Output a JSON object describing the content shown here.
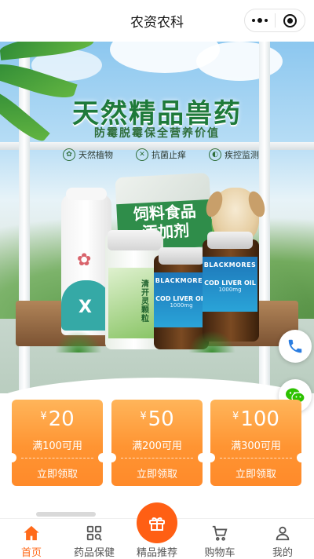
{
  "header": {
    "title": "农资农科",
    "menu_icon": "more-dots-icon",
    "close_icon": "target-close-icon"
  },
  "banner": {
    "headline": "天然精品兽药",
    "subline": "防霉脱霉保全营养价值",
    "features": [
      {
        "icon": "leaf-icon",
        "label": "天然植物"
      },
      {
        "icon": "shield-icon",
        "label": "抗菌止痒"
      },
      {
        "icon": "monitor-icon",
        "label": "疾控监测"
      }
    ],
    "bag_text_1": "饲料食品",
    "bag_text_2": "添加剂",
    "green_bottle_text": "清开灵颗粒",
    "brand": "BLACKMORES",
    "product": "COD LIVER OIL",
    "dose": "1000mg"
  },
  "floats": {
    "phone_icon": "phone-icon",
    "wechat_icon": "wechat-icon"
  },
  "coupons": [
    {
      "symbol": "¥",
      "amount": "20",
      "condition": "满100可用",
      "action": "立即领取"
    },
    {
      "symbol": "¥",
      "amount": "50",
      "condition": "满200可用",
      "action": "立即领取"
    },
    {
      "symbol": "¥",
      "amount": "100",
      "condition": "满300可用",
      "action": "立即领取"
    }
  ],
  "tabbar": {
    "items": [
      {
        "label": "首页",
        "icon": "home-icon",
        "active": true
      },
      {
        "label": "药品保健",
        "icon": "grid-search-icon",
        "active": false
      },
      {
        "label": "精品推荐",
        "icon": "gift-icon",
        "active": false
      },
      {
        "label": "购物车",
        "icon": "cart-icon",
        "active": false
      },
      {
        "label": "我的",
        "icon": "user-icon",
        "active": false
      }
    ]
  },
  "colors": {
    "accent": "#ff6a1a",
    "coupon_top": "#ffb55a",
    "coupon_bottom": "#ff8a2a",
    "headline": "#1f7a3a"
  }
}
